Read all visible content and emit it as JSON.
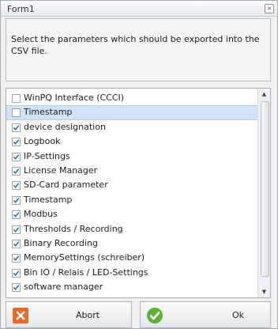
{
  "window": {
    "title": "Form1"
  },
  "description": "Select the parameters which should be exported into the CSV file.",
  "items": [
    {
      "label": "WinPQ Interface (CCCI)",
      "checked": false,
      "selected": false
    },
    {
      "label": "Timestamp",
      "checked": false,
      "selected": true
    },
    {
      "label": "device designation",
      "checked": true,
      "selected": false
    },
    {
      "label": "Logbook",
      "checked": true,
      "selected": false
    },
    {
      "label": "IP-Settings",
      "checked": true,
      "selected": false
    },
    {
      "label": "License Manager",
      "checked": true,
      "selected": false
    },
    {
      "label": "SD-Card parameter",
      "checked": true,
      "selected": false
    },
    {
      "label": "Timestamp",
      "checked": true,
      "selected": false
    },
    {
      "label": "Modbus",
      "checked": true,
      "selected": false
    },
    {
      "label": "Thresholds / Recording",
      "checked": true,
      "selected": false
    },
    {
      "label": "Binary Recording",
      "checked": true,
      "selected": false
    },
    {
      "label": "MemorySettings (schreiber)",
      "checked": true,
      "selected": false
    },
    {
      "label": "Bin IO / Relais / LED-Settings",
      "checked": true,
      "selected": false
    },
    {
      "label": "software manager",
      "checked": true,
      "selected": false
    }
  ],
  "buttons": {
    "abort": "Abort",
    "ok": "Ok"
  },
  "icons": {
    "close": "close-icon",
    "abort": "abort-x-icon",
    "ok": "ok-check-icon"
  },
  "colors": {
    "selection": "#d3e3f7",
    "check": "#2e6dba",
    "abort": "#ea6a24",
    "ok": "#5bb332"
  }
}
